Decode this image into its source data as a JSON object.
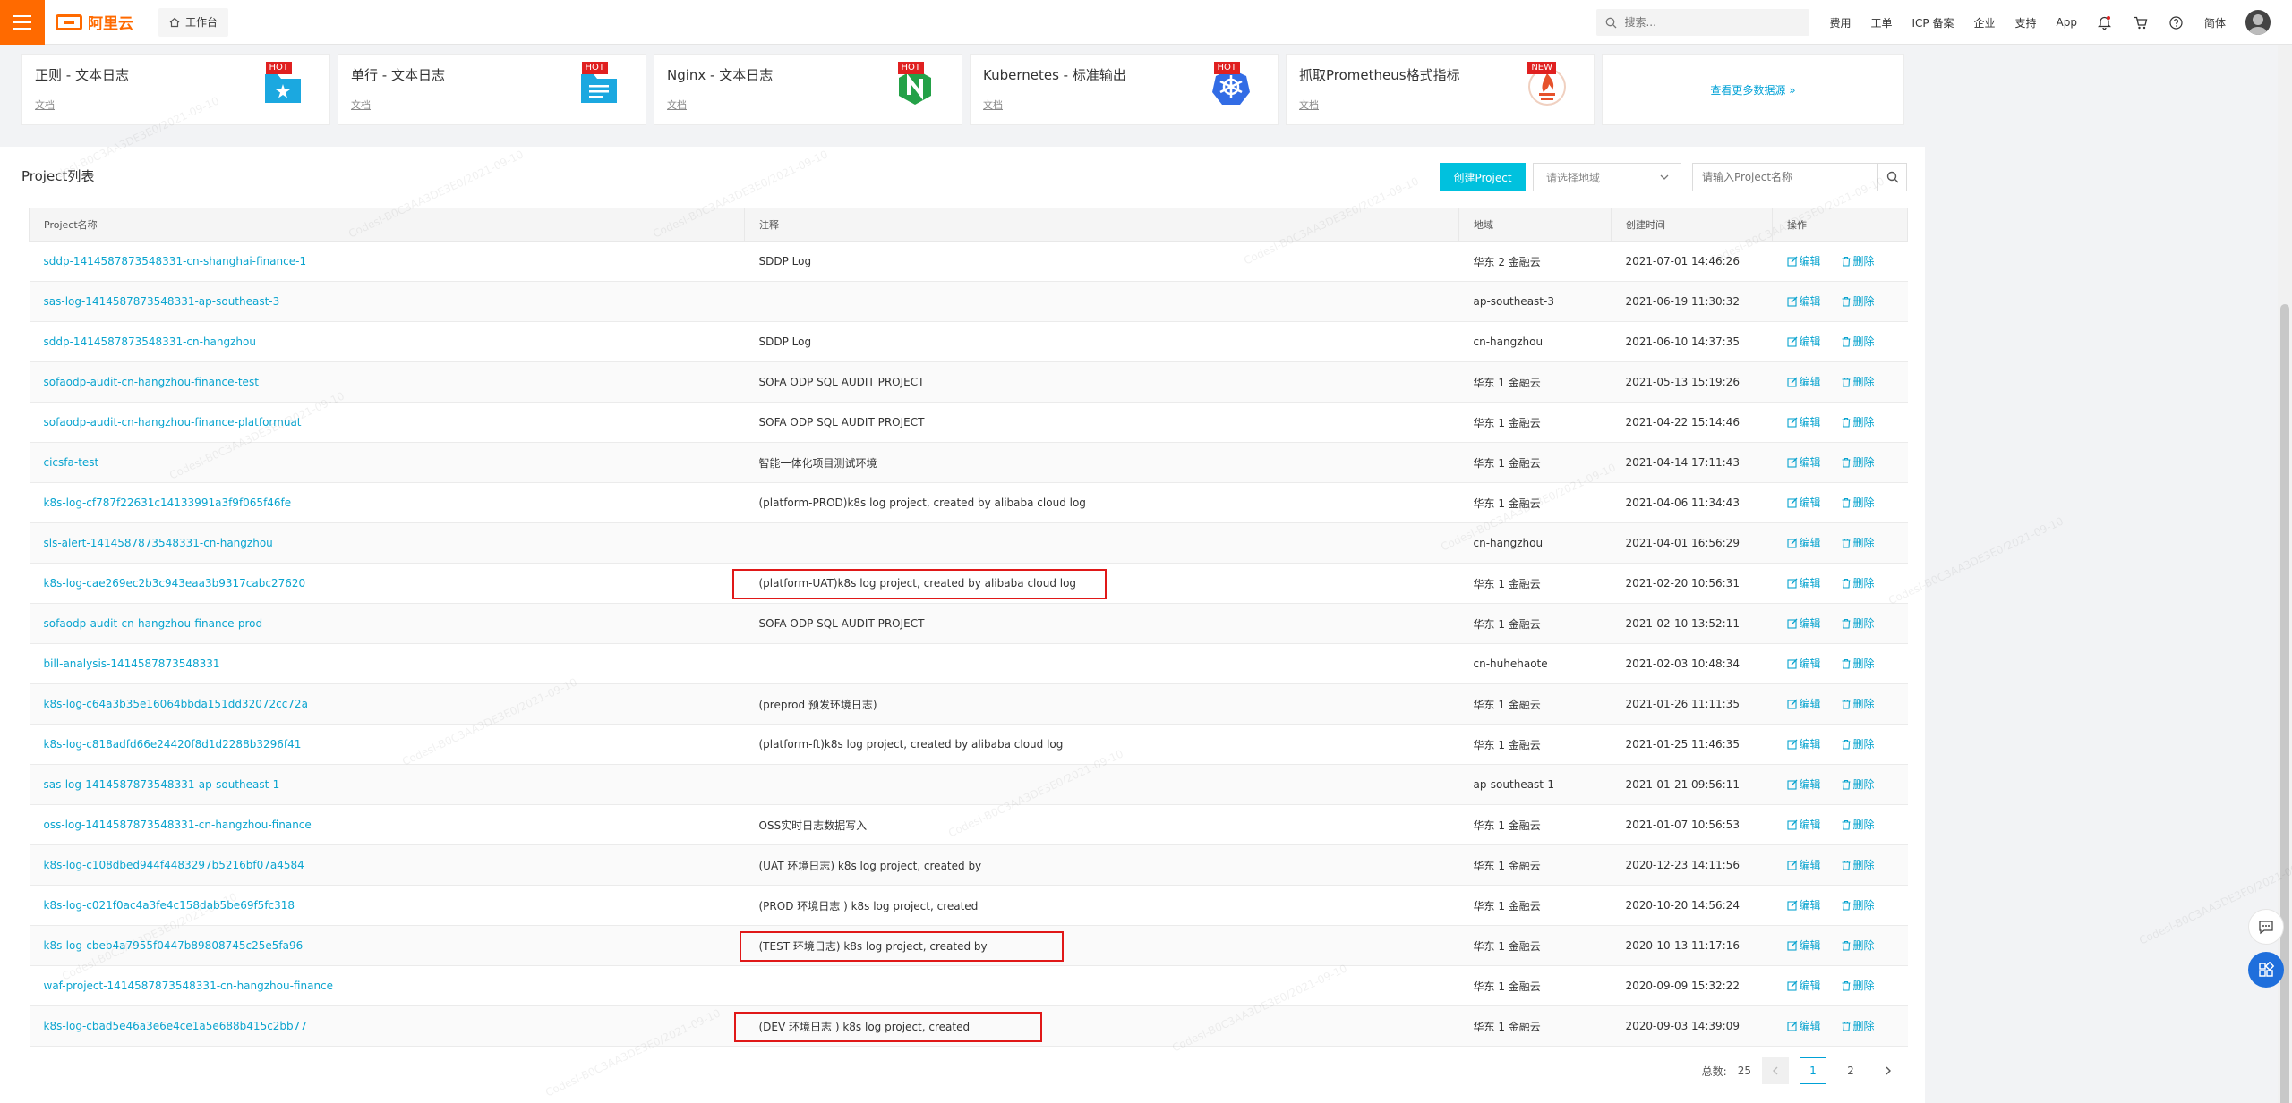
{
  "topbar": {
    "logo_text": "阿里云",
    "workspace_label": "工作台",
    "search_placeholder": "搜索...",
    "links": [
      "费用",
      "工单",
      "ICP 备案",
      "企业",
      "支持",
      "App"
    ],
    "lang": "简体"
  },
  "datasources": [
    {
      "title": "正则 - 文本日志",
      "doc": "文档",
      "badge": "HOT",
      "icon": "folder-star-icon",
      "color": "#1ba8e0"
    },
    {
      "title": "单行 - 文本日志",
      "doc": "文档",
      "badge": "HOT",
      "icon": "document-lines-icon",
      "color": "#1ba8e0"
    },
    {
      "title": "Nginx - 文本日志",
      "doc": "文档",
      "badge": "HOT",
      "icon": "nginx-icon",
      "color": "#24a148"
    },
    {
      "title": "Kubernetes - 标准输出",
      "doc": "文档",
      "badge": "HOT",
      "icon": "kubernetes-icon",
      "color": "#326ce5"
    },
    {
      "title": "抓取Prometheus格式指标",
      "doc": "文档",
      "badge": "NEW",
      "icon": "prometheus-icon",
      "color": "#e6522c"
    }
  ],
  "datasource_more": "查看更多数据源 »",
  "project_panel": {
    "title": "Project列表",
    "create_label": "创建Project",
    "region_placeholder": "请选择地域",
    "search_placeholder": "请输入Project名称",
    "columns": [
      "Project名称",
      "注释",
      "地域",
      "创建时间",
      "操作"
    ],
    "edit_label": "编辑",
    "delete_label": "删除",
    "rows": [
      {
        "name": "sddp-1414587873548331-cn-shanghai-finance-1",
        "note": "SDDP Log",
        "region": "华东 2 金融云",
        "time": "2021-07-01 14:46:26"
      },
      {
        "name": "sas-log-1414587873548331-ap-southeast-3",
        "note": "",
        "region": "ap-southeast-3",
        "time": "2021-06-19 11:30:32"
      },
      {
        "name": "sddp-1414587873548331-cn-hangzhou",
        "note": "SDDP Log",
        "region": "cn-hangzhou",
        "time": "2021-06-10 14:37:35"
      },
      {
        "name": "sofaodp-audit-cn-hangzhou-finance-test",
        "note": "SOFA ODP SQL AUDIT PROJECT",
        "region": "华东 1 金融云",
        "time": "2021-05-13 15:19:26"
      },
      {
        "name": "sofaodp-audit-cn-hangzhou-finance-platformuat",
        "note": "SOFA ODP SQL AUDIT PROJECT",
        "region": "华东 1 金融云",
        "time": "2021-04-22 15:14:46"
      },
      {
        "name": "cicsfa-test",
        "note": "智能一体化项目测试环境",
        "region": "华东 1 金融云",
        "time": "2021-04-14 17:11:43"
      },
      {
        "name": "k8s-log-cf787f22631c14133991a3f9f065f46fe",
        "note": "(platform-PROD)k8s log project, created by alibaba cloud log",
        "region": "华东 1 金融云",
        "time": "2021-04-06 11:34:43"
      },
      {
        "name": "sls-alert-1414587873548331-cn-hangzhou",
        "note": "",
        "region": "cn-hangzhou",
        "time": "2021-04-01 16:56:29"
      },
      {
        "name": "k8s-log-cae269ec2b3c943eaa3b9317cabc27620",
        "note": "(platform-UAT)k8s log project, created by alibaba cloud log",
        "region": "华东 1 金融云",
        "time": "2021-02-20 10:56:31"
      },
      {
        "name": "sofaodp-audit-cn-hangzhou-finance-prod",
        "note": "SOFA ODP SQL AUDIT PROJECT",
        "region": "华东 1 金融云",
        "time": "2021-02-10 13:52:11"
      },
      {
        "name": "bill-analysis-1414587873548331",
        "note": "",
        "region": "cn-huhehaote",
        "time": "2021-02-03 10:48:34"
      },
      {
        "name": "k8s-log-c64a3b35e16064bbda151dd32072cc72a",
        "note": "(preprod 预发环境日志)",
        "region": "华东 1 金融云",
        "time": "2021-01-26 11:11:35"
      },
      {
        "name": "k8s-log-c818adfd66e24420f8d1d2288b3296f41",
        "note": "(platform-ft)k8s log project, created by alibaba cloud log",
        "region": "华东 1 金融云",
        "time": "2021-01-25 11:46:35"
      },
      {
        "name": "sas-log-1414587873548331-ap-southeast-1",
        "note": "",
        "region": "ap-southeast-1",
        "time": "2021-01-21 09:56:11"
      },
      {
        "name": "oss-log-1414587873548331-cn-hangzhou-finance",
        "note": "OSS实时日志数据写入",
        "region": "华东 1 金融云",
        "time": "2021-01-07 10:56:53"
      },
      {
        "name": "k8s-log-c108dbed944f4483297b5216bf07a4584",
        "note": "(UAT 环境日志) k8s log project, created by",
        "region": "华东 1 金融云",
        "time": "2020-12-23 14:11:56"
      },
      {
        "name": "k8s-log-c021f0ac4a3fe4c158dab5be69f5fc318",
        "note": "(PROD 环境日志 ) k8s log project, created",
        "region": "华东 1 金融云",
        "time": "2020-10-20 14:56:24"
      },
      {
        "name": "k8s-log-cbeb4a7955f0447b89808745c25e5fa96",
        "note": "(TEST 环境日志) k8s log project, created by",
        "region": "华东 1 金融云",
        "time": "2020-10-13 11:17:16"
      },
      {
        "name": "waf-project-1414587873548331-cn-hangzhou-finance",
        "note": "",
        "region": "华东 1 金融云",
        "time": "2020-09-09 15:32:22"
      },
      {
        "name": "k8s-log-cbad5e46a3e6e4ce1a5e688b415c2bb77",
        "note": "(DEV 环境日志 ) k8s log project, created",
        "region": "华东 1 金融云",
        "time": "2020-09-03 14:39:09"
      }
    ]
  },
  "pagination": {
    "total_label": "总数:",
    "total": "25",
    "pages": [
      "1",
      "2"
    ],
    "current": "1"
  },
  "colors": {
    "accent": "#ff6a00",
    "link": "#0aa4cf",
    "primary_button": "#00c1de",
    "highlight_box": "#e01818"
  },
  "watermark": "Codesl-B0C3AA3DE3E0/2021-09-10"
}
